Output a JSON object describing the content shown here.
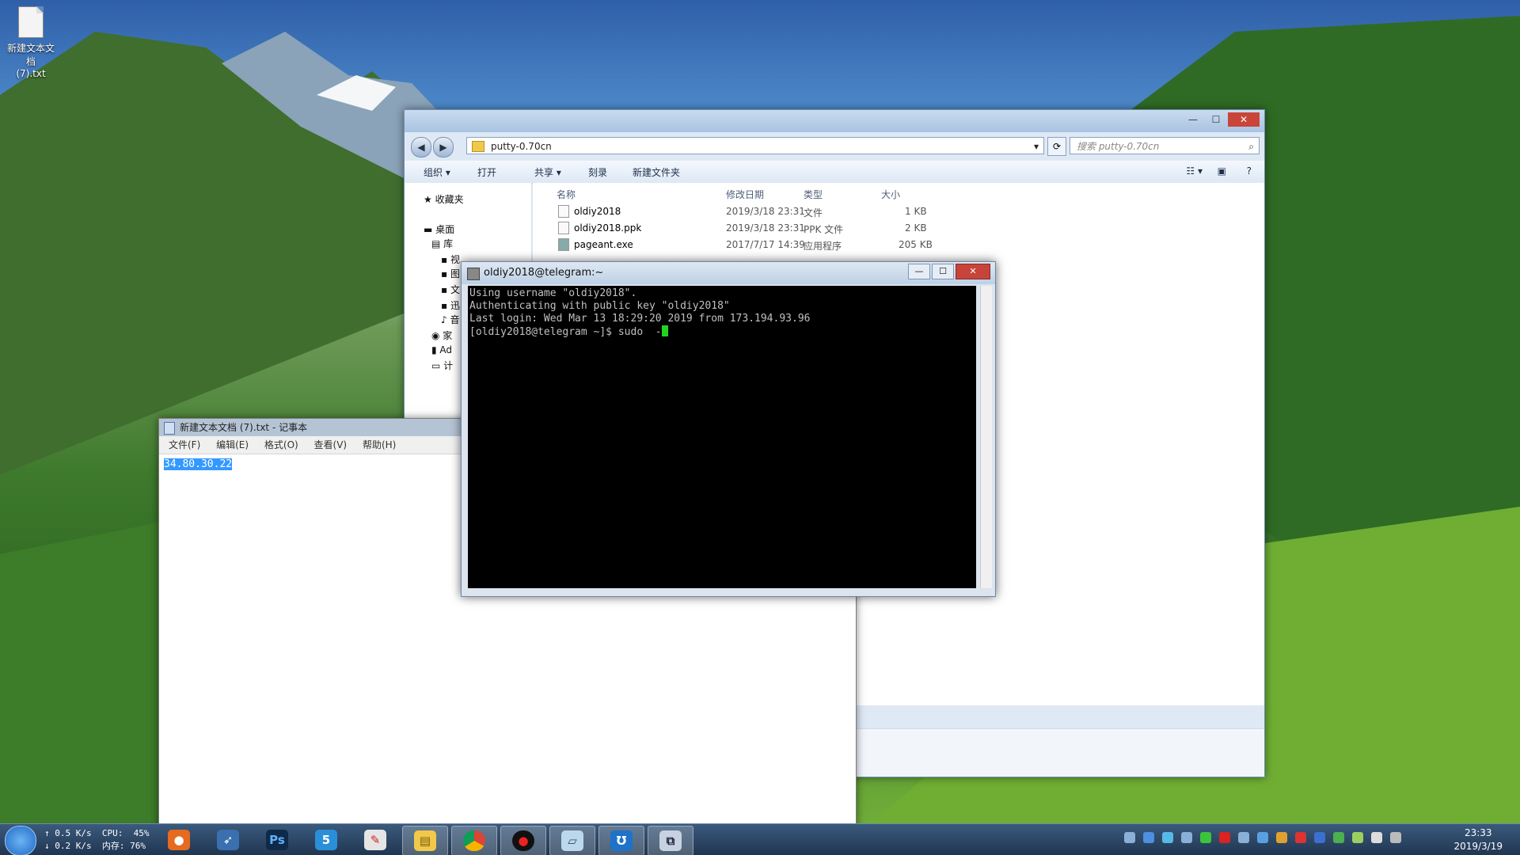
{
  "desktop": {
    "icon_label": "新建文本文档\n(7).txt"
  },
  "explorer": {
    "address": "putty-0.70cn",
    "search_placeholder": "搜索 putty-0.70cn",
    "toolbar": [
      "组织 ▾",
      "打开",
      "共享 ▾",
      "刻录",
      "新建文件夹"
    ],
    "nav": [
      "收藏夹",
      "桌面",
      "库",
      "视",
      "图",
      "文",
      "迅",
      "音",
      "家",
      "Ad",
      "计"
    ],
    "columns": [
      "名称",
      "修改日期",
      "类型",
      "大小"
    ],
    "files": [
      {
        "name": "oldiy2018",
        "date": "2019/3/18 23:31",
        "type": "文件",
        "size": "1 KB"
      },
      {
        "name": "oldiy2018.ppk",
        "date": "2019/3/18 23:31",
        "type": "PPK 文件",
        "size": "2 KB"
      },
      {
        "name": "pageant.exe",
        "date": "2017/7/17 14:39",
        "type": "应用程序",
        "size": "205 KB"
      }
    ]
  },
  "notepad": {
    "title": "新建文本文档 (7).txt - 记事本",
    "menu": [
      "文件(F)",
      "编辑(E)",
      "格式(O)",
      "查看(V)",
      "帮助(H)"
    ],
    "content": "34.80.30.22"
  },
  "putty": {
    "title": "oldiy2018@telegram:~",
    "lines": [
      "Using username \"oldiy2018\".",
      "Authenticating with public key \"oldiy2018\"",
      "Last login: Wed Mar 13 18:29:20 2019 from 173.194.93.96"
    ],
    "prompt": "[oldiy2018@telegram ~]$ sudo  -"
  },
  "taskbar": {
    "net_up": "↑ 0.5 K/s  CPU:  45%",
    "net_down": "↓ 0.2 K/s  内存: 76%",
    "time": "23:33",
    "date": "2019/3/19",
    "apps": [
      "firefox-icon",
      "swift-icon",
      "photoshop-icon",
      "s-app-icon",
      "pdf-icon",
      "file-explorer-icon",
      "chrome-icon",
      "record-icon",
      "folder-icon",
      "u-app-icon",
      "putty-icon"
    ]
  }
}
